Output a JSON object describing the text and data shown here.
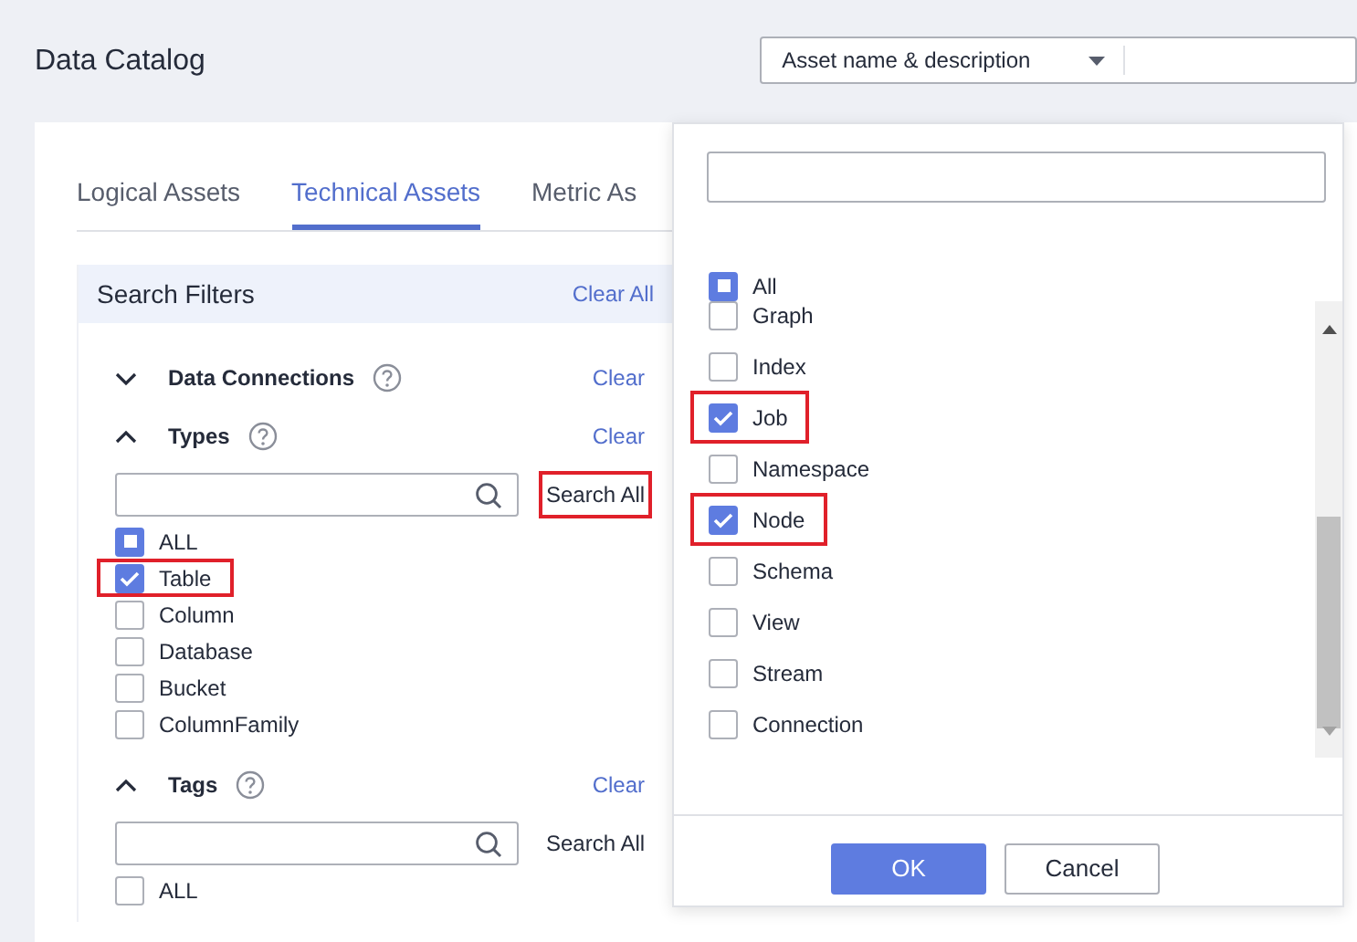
{
  "header": {
    "title": "Data Catalog",
    "search_scope": "Asset name & description"
  },
  "tabs": [
    {
      "label": "Logical Assets",
      "selected": false
    },
    {
      "label": "Technical Assets",
      "selected": true
    },
    {
      "label": "Metric As",
      "selected": false
    }
  ],
  "filters": {
    "title": "Search Filters",
    "clear_all": "Clear All",
    "sections": [
      {
        "title": "Data Connections",
        "expanded": false,
        "clear": "Clear"
      },
      {
        "title": "Types",
        "expanded": true,
        "clear": "Clear",
        "search_button": "Search All",
        "search_highlighted": true,
        "options": [
          {
            "label": "ALL",
            "checked": false,
            "indeterminate": true,
            "highlighted": false
          },
          {
            "label": "Table",
            "checked": true,
            "indeterminate": false,
            "highlighted": true
          },
          {
            "label": "Column",
            "checked": false,
            "indeterminate": false,
            "highlighted": false
          },
          {
            "label": "Database",
            "checked": false,
            "indeterminate": false,
            "highlighted": false
          },
          {
            "label": "Bucket",
            "checked": false,
            "indeterminate": false,
            "highlighted": false
          },
          {
            "label": "ColumnFamily",
            "checked": false,
            "indeterminate": false,
            "highlighted": false
          }
        ]
      },
      {
        "title": "Tags",
        "expanded": true,
        "clear": "Clear",
        "search_button": "Search All",
        "search_highlighted": false,
        "options": [
          {
            "label": "ALL",
            "checked": false,
            "indeterminate": false,
            "highlighted": false
          }
        ]
      }
    ]
  },
  "popover": {
    "all": {
      "label": "All",
      "checked": false,
      "indeterminate": true,
      "highlighted": false
    },
    "options": [
      {
        "label": "Graph",
        "checked": false,
        "highlighted": false
      },
      {
        "label": "Index",
        "checked": false,
        "highlighted": false
      },
      {
        "label": "Job",
        "checked": true,
        "highlighted": true
      },
      {
        "label": "Namespace",
        "checked": false,
        "highlighted": false
      },
      {
        "label": "Node",
        "checked": true,
        "highlighted": true
      },
      {
        "label": "Schema",
        "checked": false,
        "highlighted": false
      },
      {
        "label": "View",
        "checked": false,
        "highlighted": false
      },
      {
        "label": "Stream",
        "checked": false,
        "highlighted": false
      },
      {
        "label": "Connection",
        "checked": false,
        "highlighted": false
      }
    ],
    "buttons": [
      {
        "label": "OK",
        "kind": "primary"
      },
      {
        "label": "Cancel",
        "kind": "secondary"
      }
    ]
  }
}
